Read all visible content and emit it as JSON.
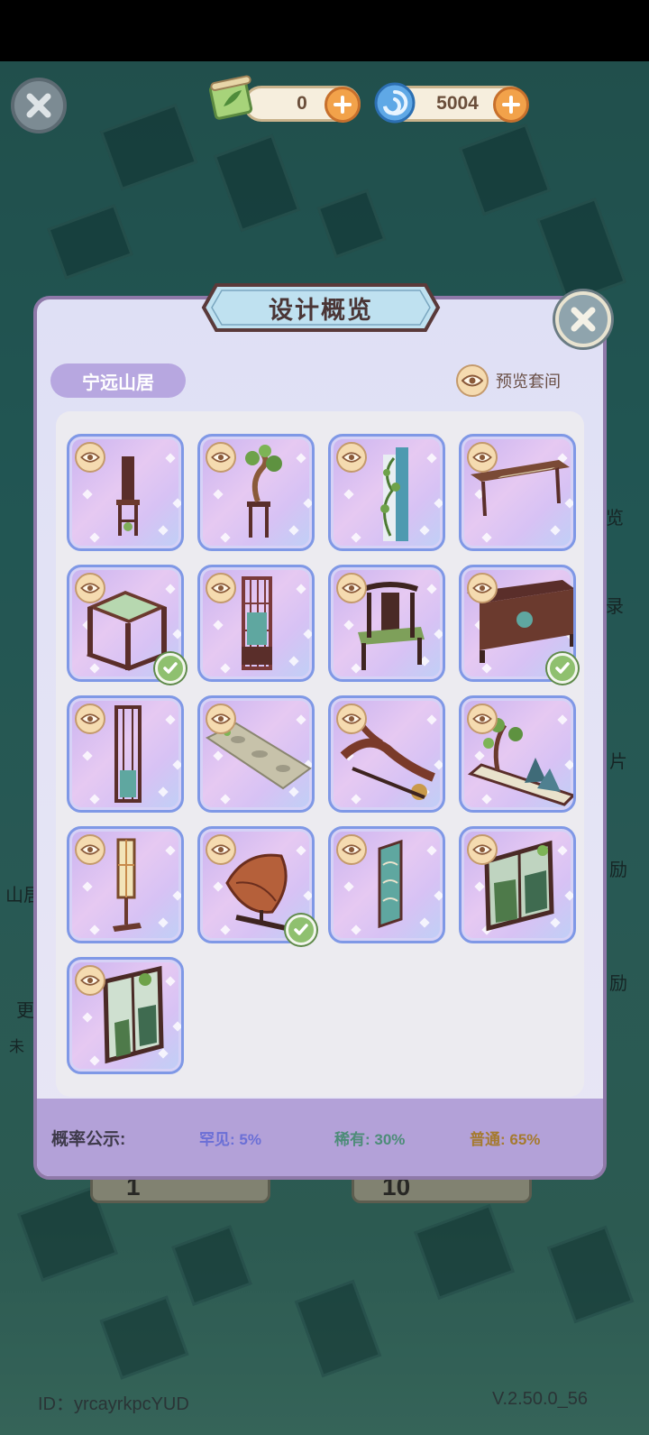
{
  "hud": {
    "scroll_currency": "0",
    "swirl_currency": "5004"
  },
  "modal": {
    "title": "设计概览",
    "suite_name": "宁远山居",
    "preview_suite_label": "预览套间",
    "rates": {
      "label": "概率公示:",
      "rare": "罕见: 5%",
      "epic": "稀有: 30%",
      "common": "普通: 65%"
    },
    "items": [
      {
        "name": "tall-back-chair",
        "owned": false
      },
      {
        "name": "bonsai-stand",
        "owned": false
      },
      {
        "name": "vine-screen",
        "owned": false
      },
      {
        "name": "long-table",
        "owned": false
      },
      {
        "name": "square-tea-table",
        "owned": true
      },
      {
        "name": "lattice-screen",
        "owned": false
      },
      {
        "name": "armchair",
        "owned": false
      },
      {
        "name": "long-cabinet",
        "owned": true
      },
      {
        "name": "lattice-panel",
        "owned": false
      },
      {
        "name": "stone-path-rug",
        "owned": false
      },
      {
        "name": "driftwood-decor",
        "owned": false
      },
      {
        "name": "landscape-bonsai",
        "owned": false
      },
      {
        "name": "floor-lamp",
        "owned": false
      },
      {
        "name": "leaf-sculpture",
        "owned": true
      },
      {
        "name": "wave-painting",
        "owned": false
      },
      {
        "name": "garden-window",
        "owned": false
      },
      {
        "name": "bamboo-window",
        "owned": false
      }
    ]
  },
  "background": {
    "side_labels": [
      "览",
      "录",
      "片",
      "励",
      "励",
      "山居",
      "更",
      "未"
    ],
    "draw_buttons": [
      "1",
      "10"
    ]
  },
  "footer": {
    "id_text": "ID：yrcayrkpcYUD",
    "version": "V.2.50.0_56"
  },
  "colors": {
    "accent_purple": "#b7a7e0",
    "card_border": "#7f98e6",
    "owned_check": "#8fc06f",
    "rare": "#6b6fd6",
    "epic": "#4d8c78",
    "common": "#a57a2e"
  }
}
